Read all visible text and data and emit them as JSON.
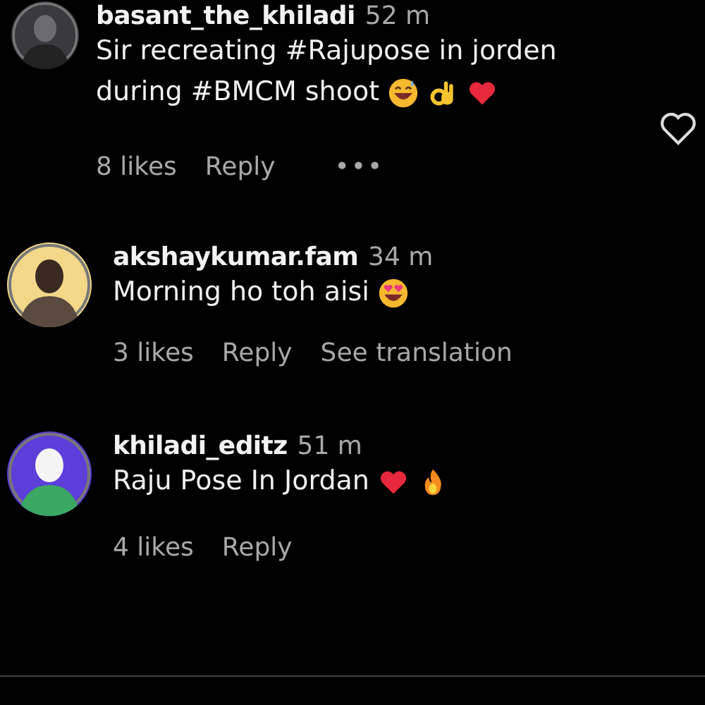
{
  "comments": [
    {
      "username": "basant_the_khiladi",
      "time": "52 m",
      "lines": [
        "Sir recreating #Rajupose in jorden",
        "during #BMCM shoot"
      ],
      "emojis": [
        {
          "kind": "grin_sweat"
        },
        {
          "kind": "ok_hand"
        },
        {
          "kind": "heart"
        }
      ],
      "actions": [
        "8 likes",
        "Reply",
        "•••"
      ],
      "liked": false
    },
    {
      "username": "akshaykumar.fam",
      "time": "34 m",
      "lines": [
        "Morning ho toh aisi"
      ],
      "emojis": [
        {
          "kind": "heart_eyes"
        }
      ],
      "actions": [
        "3 likes",
        "Reply",
        "See translation"
      ]
    },
    {
      "username": "khiladi_editz",
      "time": "51 m",
      "lines": [
        "Raju Pose In Jordan"
      ],
      "emojis": [
        {
          "kind": "heart"
        },
        {
          "kind": "fire"
        }
      ],
      "actions": [
        "4 likes",
        "Reply"
      ]
    }
  ]
}
